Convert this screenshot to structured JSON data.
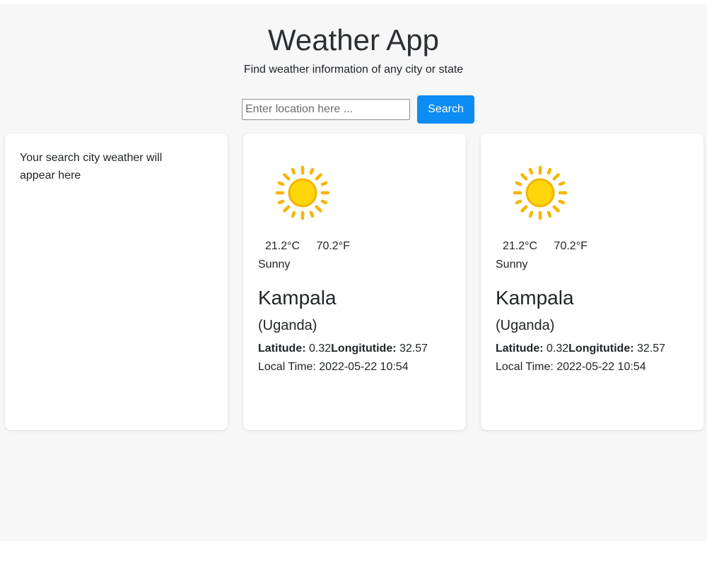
{
  "header": {
    "title": "Weather App",
    "subtitle": "Find weather information of any city or state"
  },
  "search": {
    "placeholder": "Enter location here ...",
    "value": "",
    "button_label": "Search"
  },
  "colors": {
    "accent": "#0d8cf3",
    "page_background": "#f7f7f8",
    "card_background": "#ffffff"
  },
  "placeholder_card": {
    "text": "Your search city weather will appear here"
  },
  "weather_cards": [
    {
      "icon": "sun-icon",
      "temp_c": "21.2°C",
      "temp_f": "70.2°F",
      "condition": "Sunny",
      "city": "Kampala",
      "country": "(Uganda)",
      "latitude_label": "Latitude:",
      "latitude_value": "0.32",
      "longitude_label": "Longitutide:",
      "longitude_value": "32.57",
      "local_time": "Local Time: 2022-05-22 10:54"
    },
    {
      "icon": "sun-icon",
      "temp_c": "21.2°C",
      "temp_f": "70.2°F",
      "condition": "Sunny",
      "city": "Kampala",
      "country": "(Uganda)",
      "latitude_label": "Latitude:",
      "latitude_value": "0.32",
      "longitude_label": "Longitutide:",
      "longitude_value": "32.57",
      "local_time": "Local Time: 2022-05-22 10:54"
    }
  ]
}
